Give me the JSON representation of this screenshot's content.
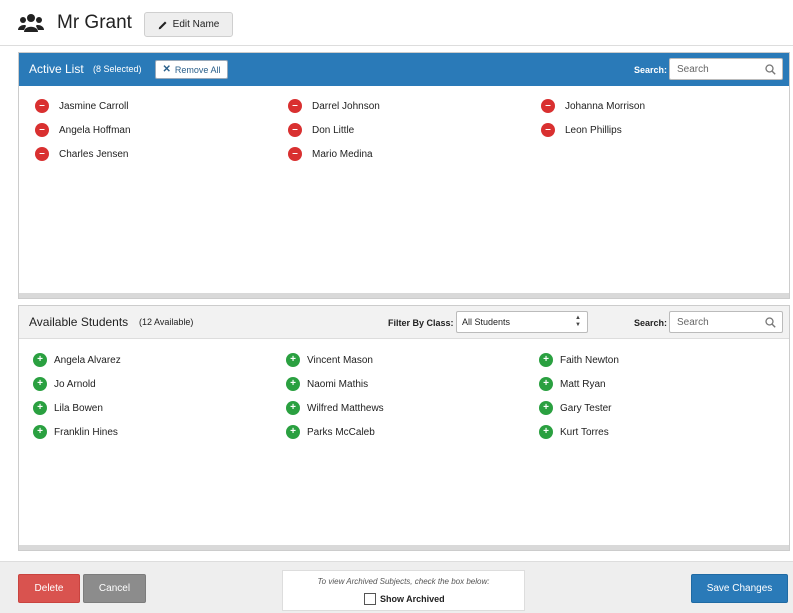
{
  "header": {
    "icon": "group-users-icon",
    "title": "Mr Grant",
    "edit_label": "Edit Name"
  },
  "active": {
    "title": "Active List",
    "count": "(8 Selected)",
    "remove_all_label": "Remove All",
    "search_label": "Search:",
    "search_placeholder": "Search",
    "search_value": "",
    "students": [
      "Jasmine Carroll",
      "Angela Hoffman",
      "Charles Jensen",
      "Darrel Johnson",
      "Don Little",
      "Mario Medina",
      "Johanna Morrison",
      "Leon Phillips"
    ]
  },
  "available": {
    "title": "Available Students",
    "count": "(12 Available)",
    "filter_label": "Filter By Class:",
    "filter_value": "All Students",
    "search_label": "Search:",
    "search_placeholder": "Search",
    "search_value": "",
    "students": [
      "Angela Alvarez",
      "Jo Arnold",
      "Lila Bowen",
      "Franklin Hines",
      "Vincent Mason",
      "Naomi Mathis",
      "Wilfred Matthews",
      "Parks McCaleb",
      "Faith Newton",
      "Matt Ryan",
      "Gary Tester",
      "Kurt Torres"
    ]
  },
  "footer": {
    "delete_label": "Delete",
    "cancel_label": "Cancel",
    "archive_hint": "To view Archived Subjects, check the box below:",
    "show_archived_label": "Show Archived",
    "show_archived_checked": false,
    "save_label": "Save Changes"
  },
  "colors": {
    "primary": "#2a7ab8",
    "remove": "#d93030",
    "add": "#2aa040",
    "delete": "#d9534f",
    "cancel": "#8c8c8c"
  }
}
